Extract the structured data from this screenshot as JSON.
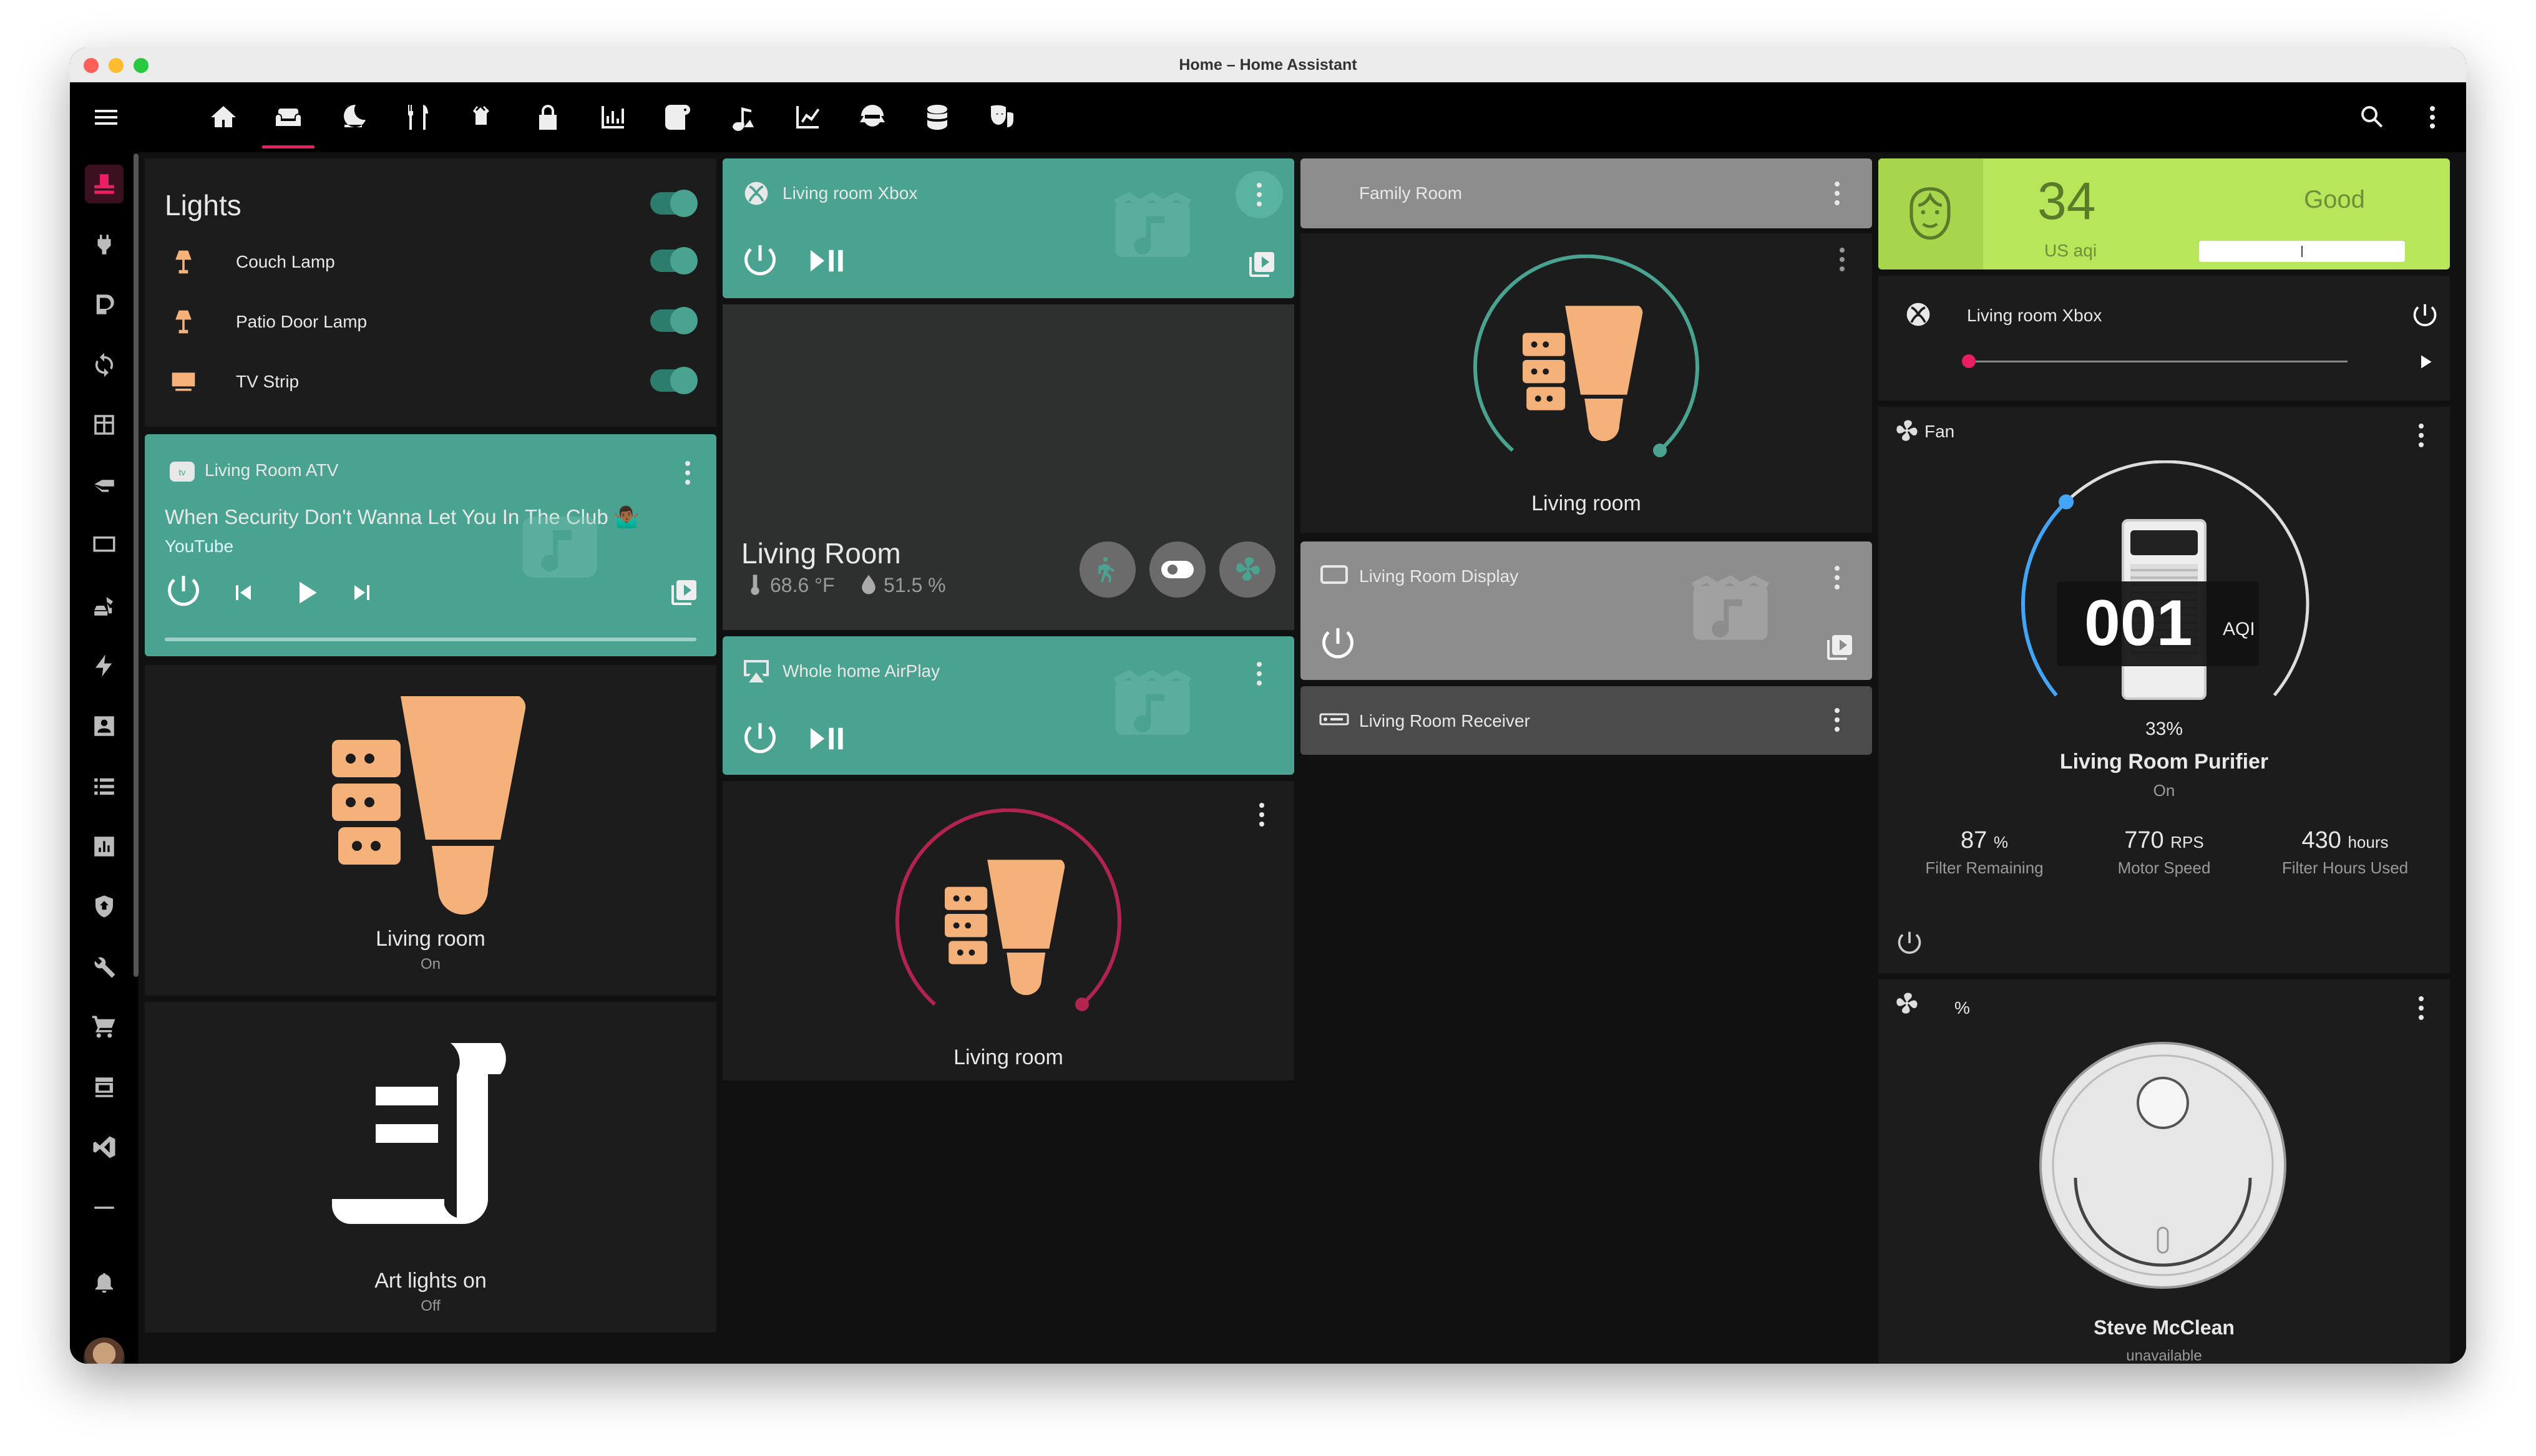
{
  "window": {
    "title": "Home – Home Assistant"
  },
  "colors": {
    "accent": "#e91e63",
    "teal": "#4aa391",
    "bulb": "#f4b27a",
    "aqi_good": "#b8e65a"
  },
  "topbar": {
    "tabs": [
      "home-icon",
      "sofa-icon",
      "weather-night-icon",
      "silverware-icon",
      "router-icon",
      "lock-icon",
      "chart-bar-icon",
      "toilet-paper-icon",
      "vacuum-icon",
      "chart-line-icon",
      "ninja-icon",
      "database-icon",
      "drama-masks-icon"
    ],
    "active_tab": 1,
    "right_icons": [
      "search-icon",
      "dots-vertical-icon"
    ]
  },
  "sidebar": {
    "items": [
      "hat-icon",
      "power-plug-icon",
      "d-icon",
      "sync-icon",
      "table-icon",
      "flashlight-icon",
      "monitor-icon",
      "excavator-icon",
      "lightning-icon",
      "account-box-icon",
      "list-icon",
      "chart-box-icon",
      "shield-home-icon",
      "wrench-icon",
      "cart-icon",
      "hacs-icon",
      "vscode-icon",
      "minus-icon",
      "bell-icon"
    ],
    "active": 0
  },
  "lights": {
    "title": "Lights",
    "items": [
      {
        "name": "Couch Lamp",
        "on": true
      },
      {
        "name": "Patio Door Lamp",
        "on": true
      },
      {
        "name": "TV Strip",
        "on": true
      }
    ]
  },
  "atv": {
    "name": "Living Room ATV",
    "track": "When Security Don't Wanna Let You In The Club 🤷🏾‍♂️",
    "app": "YouTube"
  },
  "light1": {
    "name": "Living room",
    "state": "On"
  },
  "script": {
    "name": "Art lights on",
    "state": "Off"
  },
  "xbox_card": {
    "name": "Living room Xbox"
  },
  "area": {
    "name": "Living Room",
    "temp": "68.6 °F",
    "humidity": "51.5 %"
  },
  "airplay": {
    "name": "Whole home AirPlay"
  },
  "light2": {
    "name": "Living room"
  },
  "family": {
    "name": "Family Room"
  },
  "light3": {
    "name": "Living room"
  },
  "display": {
    "name": "Living Room Display"
  },
  "receiver": {
    "name": "Living Room Receiver"
  },
  "aqi": {
    "value": "34",
    "unit": "US aqi",
    "label": "Good"
  },
  "xbox_mini": {
    "name": "Living room Xbox"
  },
  "fan": {
    "title": "Fan",
    "pct": "33%",
    "name": "Living Room Purifier",
    "state": "On",
    "aqi_value": "001",
    "aqi_label": "AQI",
    "level": 0.33,
    "stats": [
      {
        "value": "87",
        "unit": "%",
        "label": "Filter Remaining"
      },
      {
        "value": "770",
        "unit": "RPS",
        "label": "Motor Speed"
      },
      {
        "value": "430",
        "unit": "hours",
        "label": "Filter Hours Used"
      }
    ]
  },
  "vacuum": {
    "title": "%",
    "name": "Steve McClean",
    "state": "unavailable"
  }
}
